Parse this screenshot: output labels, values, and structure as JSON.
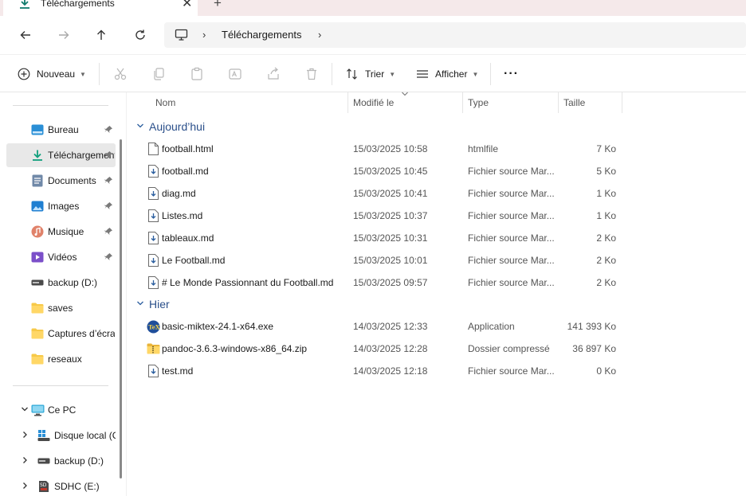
{
  "tab": {
    "title": "Téléchargements",
    "close_glyph": "✕",
    "new_tab_glyph": "+"
  },
  "address": {
    "crumb": "Téléchargements",
    "separator": "›"
  },
  "commands": {
    "new_label": "Nouveau",
    "sort_label": "Trier",
    "view_label": "Afficher",
    "more_glyph": "···"
  },
  "sidebar": {
    "quick_access": [
      {
        "label": "Bureau",
        "icon": "desktop-icon",
        "pinned": true
      },
      {
        "label": "Téléchargements",
        "icon": "download-icon",
        "pinned": true,
        "active": true
      },
      {
        "label": "Documents",
        "icon": "documents-icon",
        "pinned": true
      },
      {
        "label": "Images",
        "icon": "images-icon",
        "pinned": true
      },
      {
        "label": "Musique",
        "icon": "music-icon",
        "pinned": true
      },
      {
        "label": "Vidéos",
        "icon": "videos-icon",
        "pinned": true
      },
      {
        "label": "backup (D:)",
        "icon": "drive-icon"
      },
      {
        "label": "saves",
        "icon": "folder-icon"
      },
      {
        "label": "Captures d’écran",
        "icon": "folder-icon"
      },
      {
        "label": "reseaux",
        "icon": "folder-icon"
      }
    ],
    "this_pc": {
      "label": "Ce PC",
      "icon": "pc-icon"
    },
    "drives": [
      {
        "label": "Disque local (C:)",
        "icon": "windows-drive-icon"
      },
      {
        "label": "backup (D:)",
        "icon": "drive-icon"
      },
      {
        "label": "SDHC (E:)",
        "icon": "sd-card-icon"
      }
    ]
  },
  "columns": {
    "name": "Nom",
    "modified": "Modifié le",
    "type": "Type",
    "size": "Taille"
  },
  "groups": [
    {
      "label": "Aujourd’hui",
      "files": [
        {
          "name": "football.html",
          "date": "15/03/2025 10:58",
          "type": "htmlfile",
          "size": "7 Ko",
          "icon": "blank-file-icon"
        },
        {
          "name": "football.md",
          "date": "15/03/2025 10:45",
          "type": "Fichier source Mar...",
          "size": "5 Ko",
          "icon": "markdown-file-icon"
        },
        {
          "name": "diag.md",
          "date": "15/03/2025 10:41",
          "type": "Fichier source Mar...",
          "size": "1 Ko",
          "icon": "markdown-file-icon"
        },
        {
          "name": "Listes.md",
          "date": "15/03/2025 10:37",
          "type": "Fichier source Mar...",
          "size": "1 Ko",
          "icon": "markdown-file-icon"
        },
        {
          "name": "tableaux.md",
          "date": "15/03/2025 10:31",
          "type": "Fichier source Mar...",
          "size": "2 Ko",
          "icon": "markdown-file-icon"
        },
        {
          "name": "Le Football.md",
          "date": "15/03/2025 10:01",
          "type": "Fichier source Mar...",
          "size": "2 Ko",
          "icon": "markdown-file-icon"
        },
        {
          "name": "# Le Monde Passionnant du Football.md",
          "date": "15/03/2025 09:57",
          "type": "Fichier source Mar...",
          "size": "2 Ko",
          "icon": "markdown-file-icon"
        }
      ]
    },
    {
      "label": "Hier",
      "files": [
        {
          "name": "basic-miktex-24.1-x64.exe",
          "date": "14/03/2025 12:33",
          "type": "Application",
          "size": "141 393 Ko",
          "icon": "miktex-app-icon"
        },
        {
          "name": "pandoc-3.6.3-windows-x86_64.zip",
          "date": "14/03/2025 12:28",
          "type": "Dossier compressé",
          "size": "36 897 Ko",
          "icon": "zip-folder-icon"
        },
        {
          "name": "test.md",
          "date": "14/03/2025 12:18",
          "type": "Fichier source Mar...",
          "size": "0 Ko",
          "icon": "markdown-file-icon"
        }
      ]
    }
  ],
  "colors": {
    "accent": "#0f7b6c",
    "group_label": "#2a4f8a",
    "active_bg": "#e8e8e8",
    "tabstrip_bg": "#f5e9ea"
  }
}
